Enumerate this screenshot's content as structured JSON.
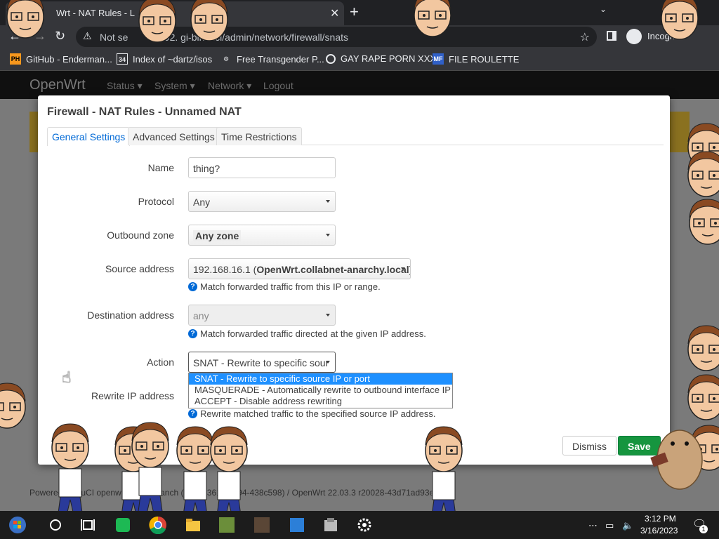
{
  "browser": {
    "tab_title": "Wrt - NAT Rules - L",
    "address": {
      "security_label": "Not se",
      "url": "192.  gi-bin/luci/admin/network/firewall/snats"
    },
    "profile_label": "Incognito",
    "bookmarks": [
      {
        "icon_text": "PH",
        "label": "GitHub - Enderman..."
      },
      {
        "icon_text": "34",
        "label": "Index of ~dartz/isos"
      },
      {
        "icon_text": "",
        "label": "Free Transgender P..."
      },
      {
        "icon_text": "",
        "label": "GAY RAPE PORN XXX"
      },
      {
        "icon_text": "MF",
        "label": "FILE ROULETTE"
      }
    ]
  },
  "openwrt": {
    "brand": "OpenWrt",
    "menu": [
      "Status ▾",
      "System ▾",
      "Network ▾",
      "Logout"
    ],
    "footer": "Powered by LuCI openwrt-22.03 branch (git-22.361.69894-438c598) / OpenWrt 22.03.3 r20028-43d71ad93e"
  },
  "modal": {
    "title": "Firewall - NAT Rules - Unnamed NAT",
    "tabs": [
      "General Settings",
      "Advanced Settings",
      "Time Restrictions"
    ],
    "fields": {
      "name": {
        "label": "Name",
        "value": "thing?"
      },
      "protocol": {
        "label": "Protocol",
        "value": "Any"
      },
      "outbound_zone": {
        "label": "Outbound zone",
        "value": "Any zone"
      },
      "source_address": {
        "label": "Source address",
        "value_ip": "192.168.16.1",
        "value_host": "OpenWrt.collabnet-anarchy.local",
        "help": "Match forwarded traffic from this IP or range."
      },
      "destination_address": {
        "label": "Destination address",
        "value": "any",
        "help": "Match forwarded traffic directed at the given IP address."
      },
      "action": {
        "label": "Action",
        "value": "SNAT - Rewrite to specific sour",
        "options": [
          "SNAT - Rewrite to specific source IP or port",
          "MASQUERADE - Automatically rewrite to outbound interface IP",
          "ACCEPT - Disable address rewriting"
        ]
      },
      "rewrite_ip": {
        "label": "Rewrite IP address",
        "help": "Rewrite matched traffic to the specified source IP address."
      }
    },
    "buttons": {
      "dismiss": "Dismiss",
      "save": "Save"
    }
  },
  "taskbar": {
    "time": "3:12 PM",
    "date": "3/16/2023",
    "notification_count": "1",
    "icons": [
      "start-icon",
      "cortana-icon",
      "task-view-icon",
      "app-green-icon",
      "chrome-icon",
      "file-explorer-icon",
      "game-icon",
      "app-cat-icon",
      "app-blue-icon",
      "app-box-icon",
      "settings-icon"
    ]
  },
  "colors": {
    "link_blue": "#0069d6",
    "save_green": "#16953f",
    "dropdown_highlight": "#1e90ff",
    "chrome_dark": "#202124"
  }
}
